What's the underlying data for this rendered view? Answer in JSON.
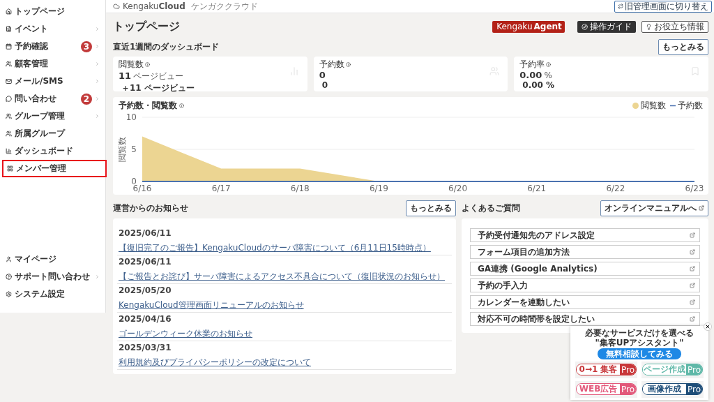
{
  "sidebar": {
    "items": [
      {
        "label": "トップページ",
        "expandable": false,
        "highlighted": false
      },
      {
        "label": "イベント",
        "expandable": true,
        "highlighted": false
      },
      {
        "label": "予約確認",
        "badge": "3",
        "expandable": true,
        "highlighted": false
      },
      {
        "label": "顧客管理",
        "expandable": true,
        "highlighted": false
      },
      {
        "label": "メール/SMS",
        "expandable": true,
        "highlighted": false
      },
      {
        "label": "問い合わせ",
        "badge": "2",
        "expandable": true,
        "highlighted": false
      },
      {
        "label": "グループ管理",
        "expandable": true,
        "highlighted": false
      },
      {
        "label": "所属グループ",
        "expandable": false,
        "highlighted": false
      },
      {
        "label": "ダッシュボード",
        "expandable": false,
        "highlighted": false
      },
      {
        "label": "メンバー管理",
        "expandable": false,
        "highlighted": true
      }
    ],
    "bottom_items": [
      {
        "label": "マイページ",
        "expandable": false
      },
      {
        "label": "サポート問い合わせ",
        "expandable": true
      },
      {
        "label": "システム設定",
        "expandable": false
      }
    ]
  },
  "header": {
    "logo_main": "Kengaku",
    "logo_bold": "Cloud",
    "logo_sub": "ケンガククラウド",
    "switch_button": "旧管理画面に切り替え"
  },
  "page": {
    "title": "トップページ",
    "agent_button": {
      "label1": "Kengaku",
      "label2": "Agent"
    },
    "guide_button": "操作ガイド",
    "info_button": "お役立ち情報"
  },
  "dashboard": {
    "title": "直近1週間のダッシュボード",
    "more_button": "もっとみる",
    "stats": [
      {
        "label": "閲覧数",
        "value": "11",
        "unit": "ページビュー",
        "sub": "＋11 ページビュー"
      },
      {
        "label": "予約数",
        "value": "0",
        "sub": "0"
      },
      {
        "label": "予約率",
        "value": "0.00",
        "unit": "%",
        "sub": "0.00 %"
      }
    ],
    "chart": {
      "title": "予約数・閲覧数",
      "chart_data": {
        "type": "area",
        "ylabel": "閲覧数",
        "categories": [
          "6/16",
          "6/17",
          "6/18",
          "6/19",
          "6/20",
          "6/21",
          "6/22",
          "6/23"
        ],
        "ylim": [
          0,
          10
        ],
        "yticks": [
          0,
          5,
          10
        ],
        "series": [
          {
            "name": "閲覧数",
            "color": "#ecd592",
            "values": [
              7,
              2,
              2,
              0,
              0,
              0,
              0,
              0
            ]
          },
          {
            "name": "予約数",
            "color": "#4a72b0",
            "values": [
              0,
              0,
              0,
              0,
              0,
              0,
              0,
              0
            ]
          }
        ]
      }
    }
  },
  "notices": {
    "title": "運営からのお知らせ",
    "more_button": "もっとみる",
    "items": [
      {
        "date": "2025/06/11",
        "title": "【復旧完了のご報告】KengakuCloudのサーバ障害について（6月11日15時時点）"
      },
      {
        "date": "2025/06/11",
        "title": "【ご報告とお詫び】サーバ障害によるアクセス不具合について（復旧状況のお知らせ）"
      },
      {
        "date": "2025/05/20",
        "title": "KengakuCloud管理画面リニューアルのお知らせ"
      },
      {
        "date": "2025/04/16",
        "title": "ゴールデンウィーク休業のお知らせ"
      },
      {
        "date": "2025/03/31",
        "title": "利用規約及びプライバシーポリシーの改定について"
      }
    ]
  },
  "faq": {
    "title": "よくあるご質問",
    "manual_button": "オンラインマニュアルへ",
    "items": [
      "予約受付通知先のアドレス設定",
      "フォーム項目の追加方法",
      "GA連携 (Google Analytics)",
      "予約の手入力",
      "カレンダーを連動したい",
      "対応不可の時間帯を設定したい"
    ]
  },
  "promo": {
    "lead": "必要なサービスだけを選べる",
    "title": "\"集客UPアシスタント\"",
    "cta": "無料相談してみる",
    "cards": [
      {
        "label": "0→1 集客",
        "tag": "Pro",
        "color": "#c8373a"
      },
      {
        "label": "ページ作成",
        "tag": "Pro",
        "color": "#5fb8a8"
      },
      {
        "label": "WEB広告",
        "tag": "Pro",
        "color": "#e2587a"
      },
      {
        "label": "画像作成",
        "tag": "Pro",
        "color": "#1f4e79"
      }
    ]
  }
}
